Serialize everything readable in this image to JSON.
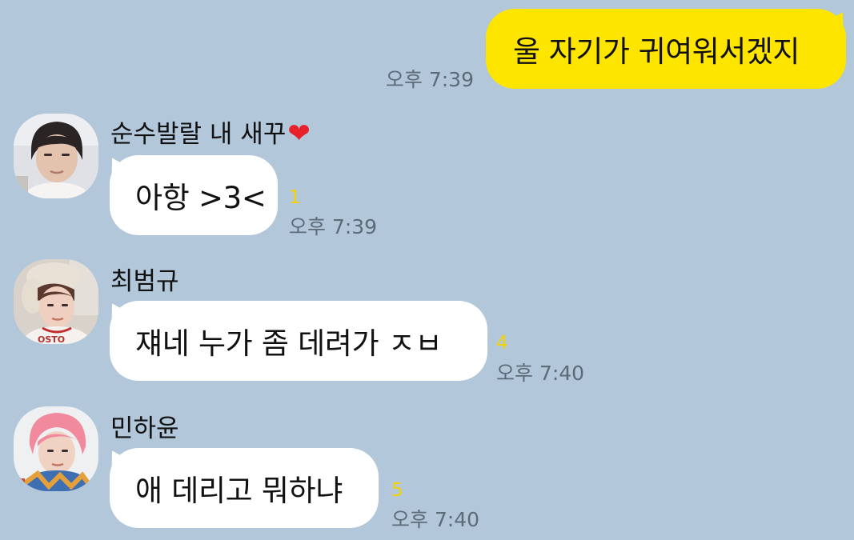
{
  "messages": {
    "sent": {
      "text": "울 자기가 귀여워서겠지",
      "time": "오후 7:39",
      "bubble_color": "#fee500"
    },
    "received": [
      {
        "sender": "순수발랄 내 새꾸",
        "sender_emoji": "❤",
        "text": "아항 >3<",
        "unread": "1",
        "time": "오후 7:39"
      },
      {
        "sender": "최범규",
        "text": "쟤네 누가 좀 데려가 ㅈㅂ",
        "unread": "4",
        "time": "오후 7:40"
      },
      {
        "sender": "민하윤",
        "text": "애 데리고 뭐하냐",
        "unread": "5",
        "time": "오후 7:40"
      }
    ]
  },
  "colors": {
    "background": "#b2c7d9",
    "unread_count": "#f5d300",
    "timestamp": "#5d6b78",
    "received_bubble": "#ffffff"
  }
}
